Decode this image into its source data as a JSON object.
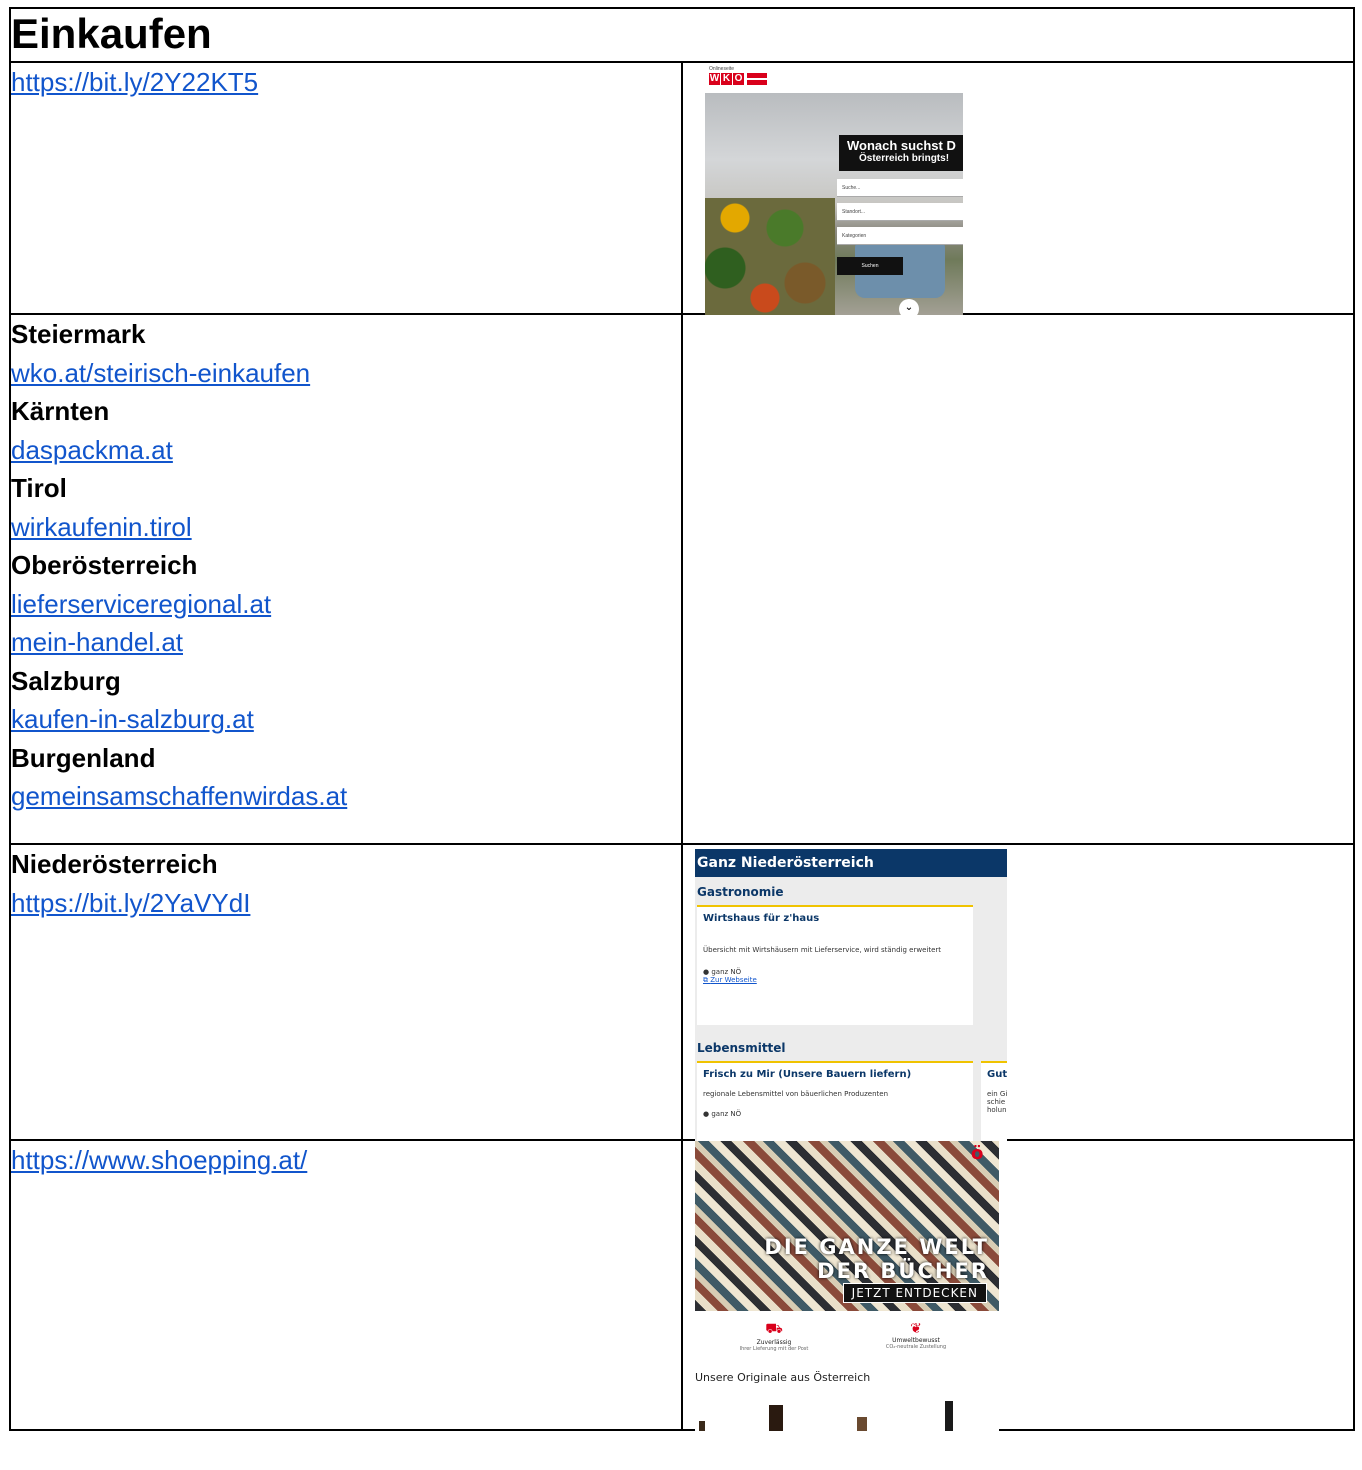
{
  "title": "Einkaufen",
  "rows": [
    {
      "link": "https://bit.ly/2Y22KT5"
    },
    {
      "entries": [
        {
          "region": "Steiermark",
          "links": [
            "wko.at/steirisch-einkaufen"
          ]
        },
        {
          "region": "Kärnten",
          "links": [
            "daspackma.at"
          ]
        },
        {
          "region": "Tirol",
          "links": [
            "wirkaufenin.tirol"
          ]
        },
        {
          "region": "Oberösterreich",
          "links": [
            "lieferserviceregional.at",
            "mein-handel.at"
          ]
        },
        {
          "region": "Salzburg",
          "links": [
            "kaufen-in-salzburg.at"
          ]
        },
        {
          "region": "Burgenland",
          "links": [
            "gemeinsamschaffenwirdas.at"
          ]
        }
      ]
    },
    {
      "region": "Niederösterreich",
      "link": "https://bit.ly/2YaVYdI"
    },
    {
      "link": "https://www.shoepping.at/"
    }
  ],
  "wko": {
    "small": "Onlineseite",
    "logo": [
      "W",
      "K",
      "O"
    ],
    "headline": "Wonach suchst D",
    "subline": "Österreich bringts!",
    "search_placeholder": "Suche...",
    "location_placeholder": "Standort...",
    "category_placeholder": "Kategorien",
    "search_button": "Suchen",
    "scroll_icon": "⌄"
  },
  "noe": {
    "header": "Ganz Niederösterreich",
    "section1": "Gastronomie",
    "card1": {
      "title": "Wirtshaus für z'haus",
      "desc": "Übersicht mit Wirtshäusern mit Lieferservice, wird ständig erweitert",
      "location": "ganz NÖ",
      "web": "Zur Webseite"
    },
    "section2": "Lebensmittel",
    "card2": {
      "title": "Frisch zu Mir (Unsere Bauern liefern)",
      "desc": "regionale Lebensmittel von bäuerlichen Produzenten",
      "location": "ganz NÖ"
    },
    "card3": {
      "title": "Gut",
      "lines": [
        "ein Gi",
        "schie",
        "holun"
      ]
    }
  },
  "shop": {
    "line1": "DIE GANZE WELT",
    "line2": "DER BÜCHER",
    "cta": "JETZT ENTDECKEN",
    "mark": "ö",
    "feature1": {
      "title": "Zuverlässig",
      "sub": "Ihrer Lieferung mit der Post"
    },
    "feature2": {
      "title": "Umweltbewusst",
      "sub": "CO₂-neutrale Zustellung"
    },
    "originals": "Unsere Originale aus Österreich"
  },
  "colors": {
    "link": "#1155cc",
    "wko_red": "#d9001b",
    "noe_blue": "#0b3768",
    "noe_accent": "#f0c300"
  }
}
